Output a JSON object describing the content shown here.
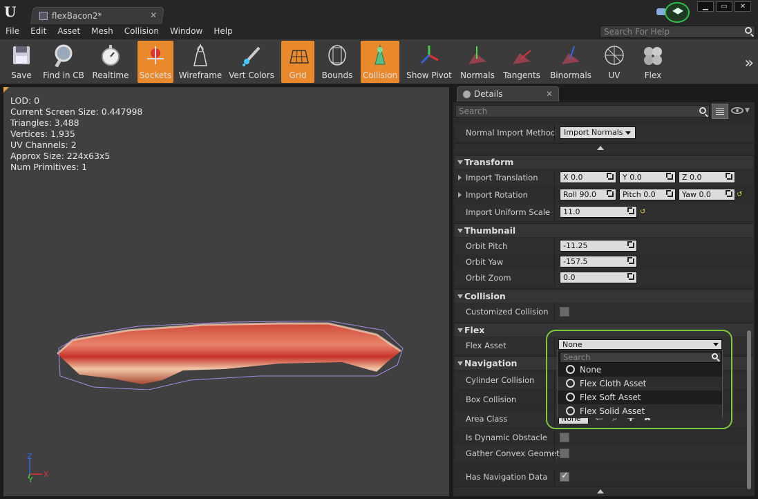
{
  "window": {
    "tab_title": "flexBacon2*",
    "tab_close": "✕"
  },
  "menu": [
    "File",
    "Edit",
    "Asset",
    "Mesh",
    "Collision",
    "Window",
    "Help"
  ],
  "help_search_placeholder": "Search For Help",
  "toolbar": [
    {
      "label": "Save",
      "icon": "save-icon",
      "active": false
    },
    {
      "label": "Find in CB",
      "icon": "magnifier-icon",
      "active": false
    },
    {
      "label": "Realtime",
      "icon": "stopwatch-icon",
      "active": false
    },
    {
      "label": "Sockets",
      "icon": "sockets-icon",
      "active": true
    },
    {
      "label": "Wireframe",
      "icon": "wireframe-icon",
      "active": false
    },
    {
      "label": "Vert Colors",
      "icon": "brush-icon",
      "active": false
    },
    {
      "label": "Grid",
      "icon": "grid-icon",
      "active": true
    },
    {
      "label": "Bounds",
      "icon": "bounds-icon",
      "active": false
    },
    {
      "label": "Collision",
      "icon": "collision-icon",
      "active": true
    },
    {
      "label": "Show Pivot",
      "icon": "pivot-icon",
      "active": false
    },
    {
      "label": "Normals",
      "icon": "normals-icon",
      "active": false
    },
    {
      "label": "Tangents",
      "icon": "tangents-icon",
      "active": false
    },
    {
      "label": "Binormals",
      "icon": "binormals-icon",
      "active": false
    },
    {
      "label": "UV",
      "icon": "uv-icon",
      "active": false
    },
    {
      "label": "Flex",
      "icon": "flex-icon",
      "active": false
    }
  ],
  "viewport": {
    "stats": [
      "LOD:  0",
      "Current Screen Size:  0.447998",
      "Triangles:  3,488",
      "Vertices:  1,935",
      "UV Channels:  2",
      "Approx Size:  224x63x5",
      "Num Primitives:  1"
    ],
    "axis_x": "X",
    "axis_y": "Y",
    "axis_z": "Z"
  },
  "details": {
    "tab_label": "Details",
    "tab_close": "✕",
    "search_placeholder": "Search",
    "normal_import_label": "Normal Import Method",
    "normal_import_value": "Import Normals",
    "sections": {
      "transform": "Transform",
      "thumbnail": "Thumbnail",
      "collision": "Collision",
      "flex": "Flex",
      "navigation": "Navigation"
    },
    "import_translation": {
      "label": "Import Translation",
      "x": "X  0.0",
      "y": "Y  0.0",
      "z": "Z  0.0"
    },
    "import_rotation": {
      "label": "Import Rotation",
      "roll": "Roll  90.0",
      "pitch": "Pitch  0.0",
      "yaw": "Yaw  0.0"
    },
    "import_uniform_scale": {
      "label": "Import Uniform Scale",
      "value": "11.0"
    },
    "orbit_pitch": {
      "label": "Orbit Pitch",
      "value": "-11.25"
    },
    "orbit_yaw": {
      "label": "Orbit Yaw",
      "value": "-157.5"
    },
    "orbit_zoom": {
      "label": "Orbit Zoom",
      "value": "0.0"
    },
    "customized_collision": {
      "label": "Customized Collision",
      "checked": false
    },
    "flex_asset": {
      "label": "Flex Asset",
      "value": "None"
    },
    "nav": {
      "cylinder": "Cylinder Collision",
      "box": "Box Collision",
      "area_class": "Area Class",
      "area_class_value": "None",
      "dynamic_obstacle": "Is Dynamic Obstacle",
      "gather_convex": "Gather Convex Geometry",
      "has_nav_data": "Has Navigation Data"
    }
  },
  "dropdown": {
    "search_placeholder": "Search",
    "items": [
      "None",
      "Flex Cloth Asset",
      "Flex Soft Asset",
      "Flex Solid Asset"
    ]
  },
  "colors": {
    "active_button": "#e9892b",
    "highlight": "#7ec83b",
    "panel": "#2b2b2b"
  }
}
